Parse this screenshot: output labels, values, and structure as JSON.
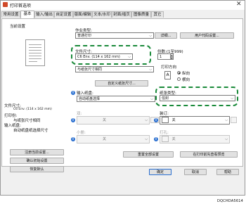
{
  "window": {
    "title": "打印首选项",
    "close": "✕"
  },
  "tabs": [
    "常用设置",
    "基本",
    "输入/输出",
    "自定设置",
    "版面/编辑",
    "文本/水印",
    "封面/插页",
    "图像质量",
    "其它"
  ],
  "left": {
    "heading": "当前设置",
    "summary": [
      "文件尺寸:",
      "C6 Env. (114 x 162 mm)",
      "打印份:",
      "与纸张尺寸相同",
      "输入纸盘:",
      "自动纸盘纸选择尺寸"
    ],
    "buttons": [
      "注册当前设置...",
      "确认初始设置",
      "恢复默认"
    ]
  },
  "job": {
    "label": "作业类型:",
    "value": "普通打印",
    "details": "详细...",
    "user_code": "用户代码设置..."
  },
  "doc": {
    "label": "文件尺寸:",
    "value": "C6 Env. (114 x 162 mm)",
    "paper_value": "与纸张尺寸相同",
    "custom": "自定义纸张尺寸..."
  },
  "tray": {
    "label": "输入纸盘:",
    "value": "自动纸盘选择"
  },
  "copies": {
    "label": "份数:(1至999)",
    "value": "1"
  },
  "orientation": {
    "label": "打印方向",
    "options": [
      "纵向",
      "横向"
    ]
  },
  "paper_type": {
    "label": "纸张类型:",
    "value": "信封"
  },
  "disabled_left": {
    "value1": "关",
    "small_label": "小册:",
    "value2": "关"
  },
  "right_lower": {
    "label1": "装订:",
    "value1": "关",
    "label2": "打孔:",
    "value2": "关"
  },
  "footer": {
    "reset": "重置全部设置",
    "preview": "在打印前先查看预览"
  },
  "dialog_buttons": [
    "确定",
    "取消",
    "帮助"
  ],
  "caption": "DQCHDA5614"
}
